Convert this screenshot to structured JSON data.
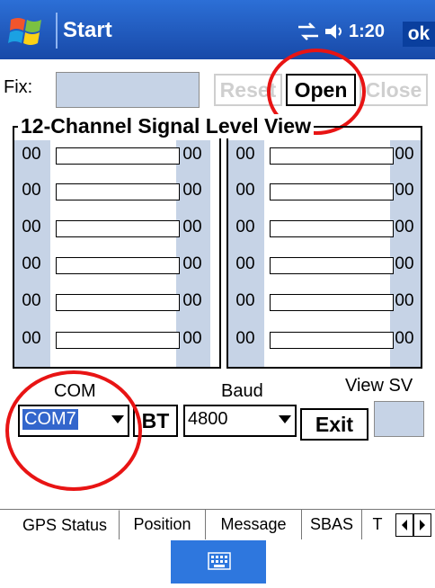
{
  "titlebar": {
    "title": "Start",
    "time": "1:20",
    "ok_label": "ok"
  },
  "toolbar": {
    "fix_label": "Fix:",
    "fix_value": "",
    "reset_label": "Reset",
    "open_label": "Open",
    "close_label": "Close"
  },
  "group": {
    "title": "12-Channel Signal Level View",
    "left_rows": [
      "00",
      "00",
      "00",
      "00",
      "00",
      "00"
    ],
    "left_right_values": [
      "00",
      "00",
      "00",
      "00",
      "00",
      "00"
    ],
    "right_rows": [
      "00",
      "00",
      "00",
      "00",
      "00",
      "00"
    ],
    "right_right_values": [
      "00",
      "00",
      "00",
      "00",
      "00",
      "00"
    ]
  },
  "controls": {
    "com_label": "COM",
    "com_value": "COM7",
    "bt_label": "BT",
    "baud_label": "Baud",
    "baud_value": "4800",
    "exit_label": "Exit",
    "viewsv_label": "View SV"
  },
  "tabs": [
    "GPS Status",
    "Position",
    "Message",
    "SBAS",
    "T"
  ],
  "colors": {
    "titlebar": "#1e5bc6",
    "field": "#c6d3e6",
    "highlight": "#e81414",
    "keyboard": "#2e77de"
  },
  "icons": [
    "windows-logo-icon",
    "connectivity-icon",
    "speaker-icon",
    "keyboard-icon",
    "arrow-left-icon",
    "arrow-right-icon"
  ]
}
